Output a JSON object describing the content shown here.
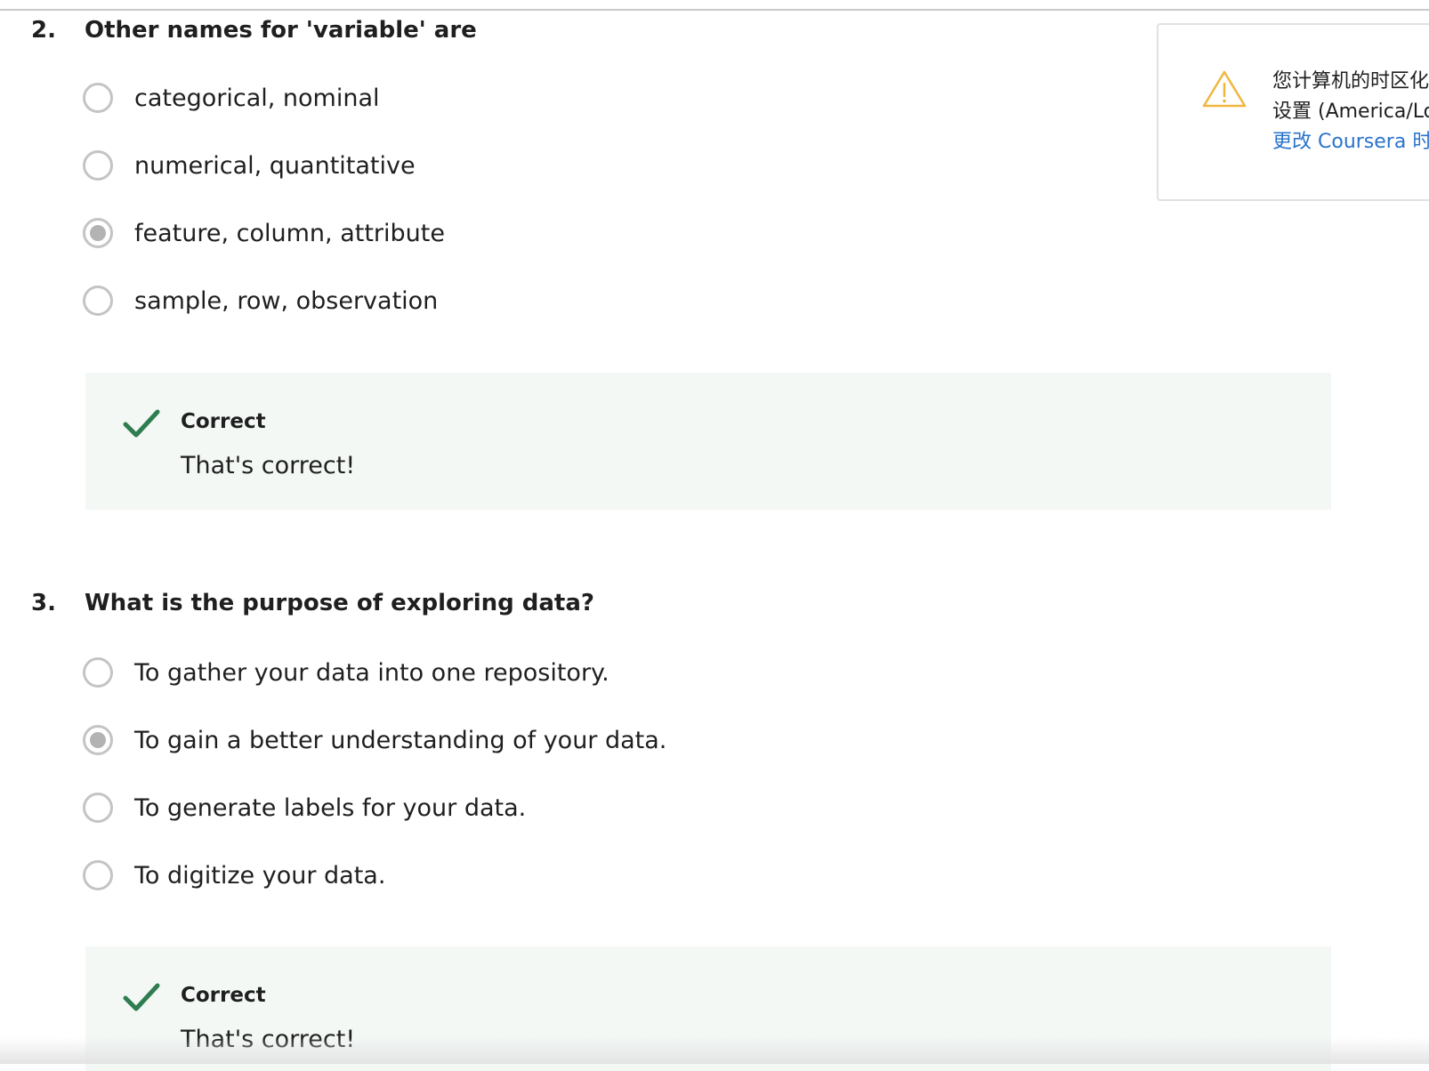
{
  "questions": [
    {
      "number": "2.",
      "text": "Other names for 'variable' are",
      "options": [
        {
          "label": "categorical, nominal",
          "selected": false
        },
        {
          "label": "numerical, quantitative",
          "selected": false
        },
        {
          "label": "feature, column, attribute",
          "selected": true
        },
        {
          "label": "sample, row, observation",
          "selected": false
        }
      ],
      "feedback": {
        "title": "Correct",
        "text": "That's correct!"
      }
    },
    {
      "number": "3.",
      "text": "What is the purpose of exploring data?",
      "options": [
        {
          "label": "To gather your data into one repository.",
          "selected": false
        },
        {
          "label": "To gain a better understanding of your data.",
          "selected": true
        },
        {
          "label": "To generate labels for your data.",
          "selected": false
        },
        {
          "label": "To digitize your data.",
          "selected": false
        }
      ],
      "feedback": {
        "title": "Correct",
        "text": "That's correct!"
      }
    }
  ],
  "timezone_notice": {
    "line1": "您计算机的时区化",
    "line2": "设置 (America/Lo",
    "link": "更改 Coursera 时"
  },
  "colors": {
    "feedback_bg": "#f3f8f5",
    "check_green": "#2e7d4f",
    "warning_amber": "#f0b73f",
    "link_blue": "#2a73cc",
    "radio_border": "#c4c4c4",
    "radio_selected_dot": "#b3b3b3"
  },
  "icons": {
    "check": "check-icon",
    "warning": "warning-triangle-icon"
  }
}
